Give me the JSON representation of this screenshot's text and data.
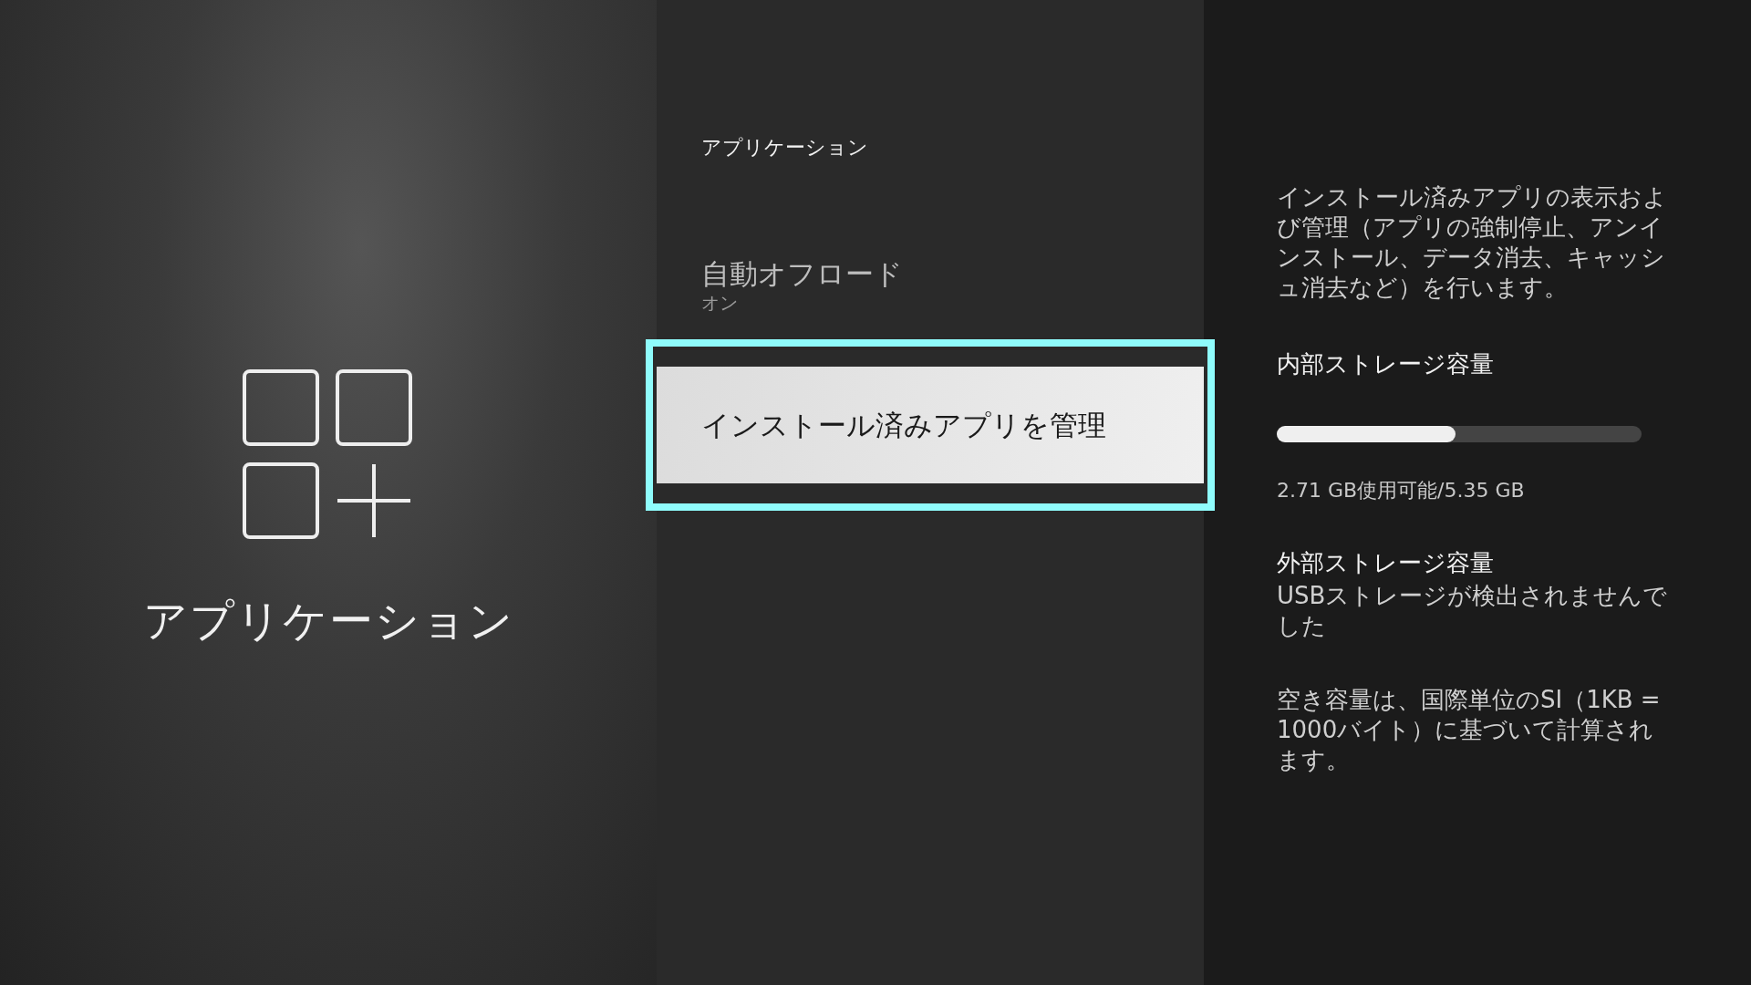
{
  "category": {
    "title": "アプリケーション"
  },
  "menu": {
    "heading": "アプリケーション",
    "items": [
      {
        "label": "自動オフロード",
        "value": "オン",
        "selected": false
      },
      {
        "label": "インストール済みアプリを管理",
        "selected": true
      }
    ]
  },
  "details": {
    "description": "インストール済みアプリの表示および管理（アプリの強制停止、アンインストール、データ消去、キャッシュ消去など）を行います。",
    "internal_storage": {
      "title": "内部ストレージ容量",
      "level": 0.49,
      "reading": "2.71 GB使用可能/5.35 GB"
    },
    "external_storage": {
      "title": "外部ストレージ容量",
      "message": "USBストレージが検出されませんでした"
    },
    "note": "空き容量は、国際単位のSI（1KB = 1000バイト）に基づいて計算されます。"
  }
}
